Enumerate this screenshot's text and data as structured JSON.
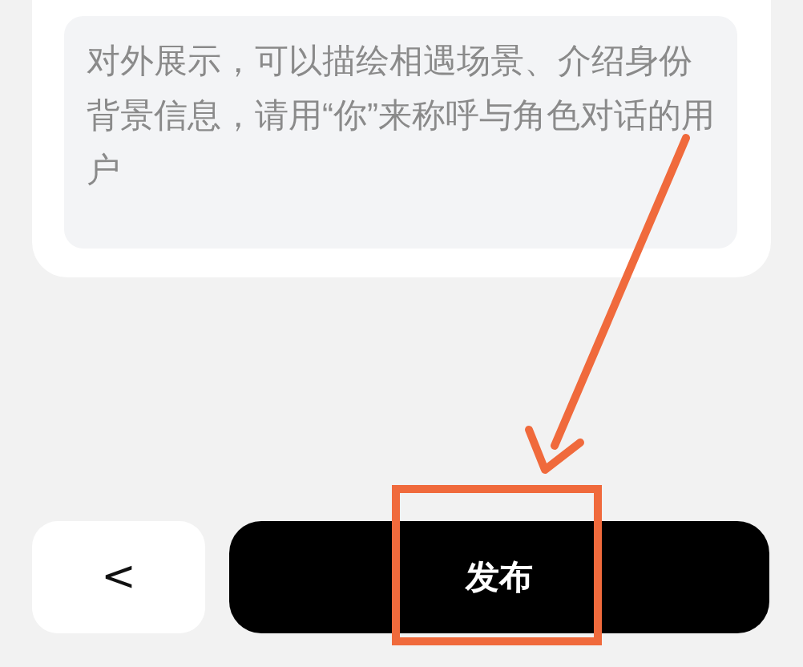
{
  "bio_field": {
    "placeholder": "对外展示，可以描绘相遇场景、介绍身份背景信息，请用“你”来称呼与角色对话的用户"
  },
  "footer": {
    "back_button": {
      "label": "<"
    },
    "publish_button": {
      "label": "发布"
    }
  }
}
